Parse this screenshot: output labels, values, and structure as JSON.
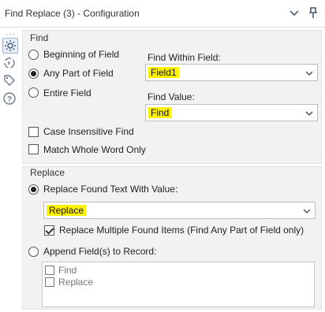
{
  "window": {
    "title": "Find Replace (3) - Configuration",
    "collapse_icon": "chevron-down-icon",
    "pin_icon": "pin-icon"
  },
  "sidebar": {
    "more": "···",
    "icons": [
      "gear-icon",
      "refresh-cycle-icon",
      "tag-icon",
      "help-icon"
    ]
  },
  "find": {
    "title": "Find",
    "options": [
      {
        "label": "Beginning of Field",
        "checked": false
      },
      {
        "label": "Any Part of Field",
        "checked": true
      },
      {
        "label": "Entire Field",
        "checked": false
      }
    ],
    "find_within_label": "Find Within Field:",
    "find_within_value": "Field1",
    "find_value_label": "Find Value:",
    "find_value_value": "Find",
    "case_insensitive": {
      "label": "Case Insensitive Find",
      "checked": false
    },
    "whole_word": {
      "label": "Match Whole Word Only",
      "checked": false
    }
  },
  "replace": {
    "title": "Replace",
    "replace_found": {
      "label": "Replace Found Text With Value:",
      "checked": true
    },
    "replace_value": "Replace",
    "replace_multiple": {
      "label": "Replace Multiple Found Items (Find Any Part of Field only)",
      "checked": true
    },
    "append_fields": {
      "label": "Append Field(s) to Record:",
      "checked": false
    },
    "append_list": [
      {
        "label": "Find",
        "checked": false
      },
      {
        "label": "Replace",
        "checked": false
      }
    ]
  },
  "colors": {
    "highlight": "#fff200",
    "panel_bg": "#f2f2f2"
  }
}
